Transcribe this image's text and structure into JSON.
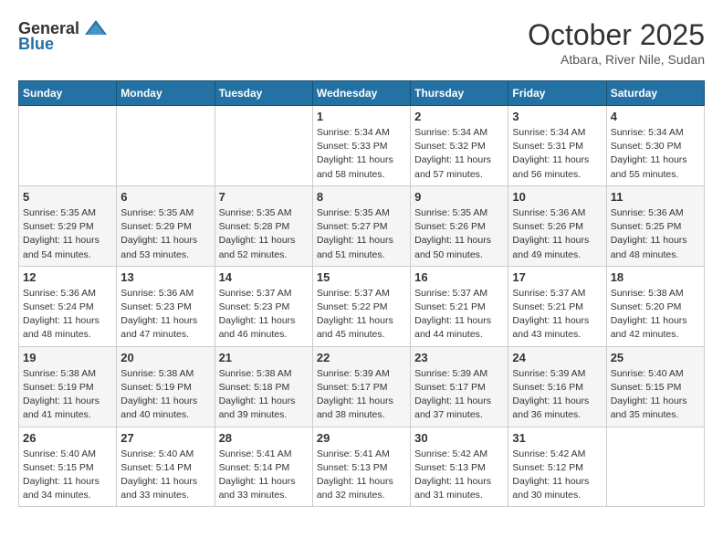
{
  "header": {
    "logo_general": "General",
    "logo_blue": "Blue",
    "month": "October 2025",
    "location": "Atbara, River Nile, Sudan"
  },
  "weekdays": [
    "Sunday",
    "Monday",
    "Tuesday",
    "Wednesday",
    "Thursday",
    "Friday",
    "Saturday"
  ],
  "weeks": [
    [
      {
        "day": "",
        "info": ""
      },
      {
        "day": "",
        "info": ""
      },
      {
        "day": "",
        "info": ""
      },
      {
        "day": "1",
        "info": "Sunrise: 5:34 AM\nSunset: 5:33 PM\nDaylight: 11 hours\nand 58 minutes."
      },
      {
        "day": "2",
        "info": "Sunrise: 5:34 AM\nSunset: 5:32 PM\nDaylight: 11 hours\nand 57 minutes."
      },
      {
        "day": "3",
        "info": "Sunrise: 5:34 AM\nSunset: 5:31 PM\nDaylight: 11 hours\nand 56 minutes."
      },
      {
        "day": "4",
        "info": "Sunrise: 5:34 AM\nSunset: 5:30 PM\nDaylight: 11 hours\nand 55 minutes."
      }
    ],
    [
      {
        "day": "5",
        "info": "Sunrise: 5:35 AM\nSunset: 5:29 PM\nDaylight: 11 hours\nand 54 minutes."
      },
      {
        "day": "6",
        "info": "Sunrise: 5:35 AM\nSunset: 5:29 PM\nDaylight: 11 hours\nand 53 minutes."
      },
      {
        "day": "7",
        "info": "Sunrise: 5:35 AM\nSunset: 5:28 PM\nDaylight: 11 hours\nand 52 minutes."
      },
      {
        "day": "8",
        "info": "Sunrise: 5:35 AM\nSunset: 5:27 PM\nDaylight: 11 hours\nand 51 minutes."
      },
      {
        "day": "9",
        "info": "Sunrise: 5:35 AM\nSunset: 5:26 PM\nDaylight: 11 hours\nand 50 minutes."
      },
      {
        "day": "10",
        "info": "Sunrise: 5:36 AM\nSunset: 5:26 PM\nDaylight: 11 hours\nand 49 minutes."
      },
      {
        "day": "11",
        "info": "Sunrise: 5:36 AM\nSunset: 5:25 PM\nDaylight: 11 hours\nand 48 minutes."
      }
    ],
    [
      {
        "day": "12",
        "info": "Sunrise: 5:36 AM\nSunset: 5:24 PM\nDaylight: 11 hours\nand 48 minutes."
      },
      {
        "day": "13",
        "info": "Sunrise: 5:36 AM\nSunset: 5:23 PM\nDaylight: 11 hours\nand 47 minutes."
      },
      {
        "day": "14",
        "info": "Sunrise: 5:37 AM\nSunset: 5:23 PM\nDaylight: 11 hours\nand 46 minutes."
      },
      {
        "day": "15",
        "info": "Sunrise: 5:37 AM\nSunset: 5:22 PM\nDaylight: 11 hours\nand 45 minutes."
      },
      {
        "day": "16",
        "info": "Sunrise: 5:37 AM\nSunset: 5:21 PM\nDaylight: 11 hours\nand 44 minutes."
      },
      {
        "day": "17",
        "info": "Sunrise: 5:37 AM\nSunset: 5:21 PM\nDaylight: 11 hours\nand 43 minutes."
      },
      {
        "day": "18",
        "info": "Sunrise: 5:38 AM\nSunset: 5:20 PM\nDaylight: 11 hours\nand 42 minutes."
      }
    ],
    [
      {
        "day": "19",
        "info": "Sunrise: 5:38 AM\nSunset: 5:19 PM\nDaylight: 11 hours\nand 41 minutes."
      },
      {
        "day": "20",
        "info": "Sunrise: 5:38 AM\nSunset: 5:19 PM\nDaylight: 11 hours\nand 40 minutes."
      },
      {
        "day": "21",
        "info": "Sunrise: 5:38 AM\nSunset: 5:18 PM\nDaylight: 11 hours\nand 39 minutes."
      },
      {
        "day": "22",
        "info": "Sunrise: 5:39 AM\nSunset: 5:17 PM\nDaylight: 11 hours\nand 38 minutes."
      },
      {
        "day": "23",
        "info": "Sunrise: 5:39 AM\nSunset: 5:17 PM\nDaylight: 11 hours\nand 37 minutes."
      },
      {
        "day": "24",
        "info": "Sunrise: 5:39 AM\nSunset: 5:16 PM\nDaylight: 11 hours\nand 36 minutes."
      },
      {
        "day": "25",
        "info": "Sunrise: 5:40 AM\nSunset: 5:15 PM\nDaylight: 11 hours\nand 35 minutes."
      }
    ],
    [
      {
        "day": "26",
        "info": "Sunrise: 5:40 AM\nSunset: 5:15 PM\nDaylight: 11 hours\nand 34 minutes."
      },
      {
        "day": "27",
        "info": "Sunrise: 5:40 AM\nSunset: 5:14 PM\nDaylight: 11 hours\nand 33 minutes."
      },
      {
        "day": "28",
        "info": "Sunrise: 5:41 AM\nSunset: 5:14 PM\nDaylight: 11 hours\nand 33 minutes."
      },
      {
        "day": "29",
        "info": "Sunrise: 5:41 AM\nSunset: 5:13 PM\nDaylight: 11 hours\nand 32 minutes."
      },
      {
        "day": "30",
        "info": "Sunrise: 5:42 AM\nSunset: 5:13 PM\nDaylight: 11 hours\nand 31 minutes."
      },
      {
        "day": "31",
        "info": "Sunrise: 5:42 AM\nSunset: 5:12 PM\nDaylight: 11 hours\nand 30 minutes."
      },
      {
        "day": "",
        "info": ""
      }
    ]
  ]
}
